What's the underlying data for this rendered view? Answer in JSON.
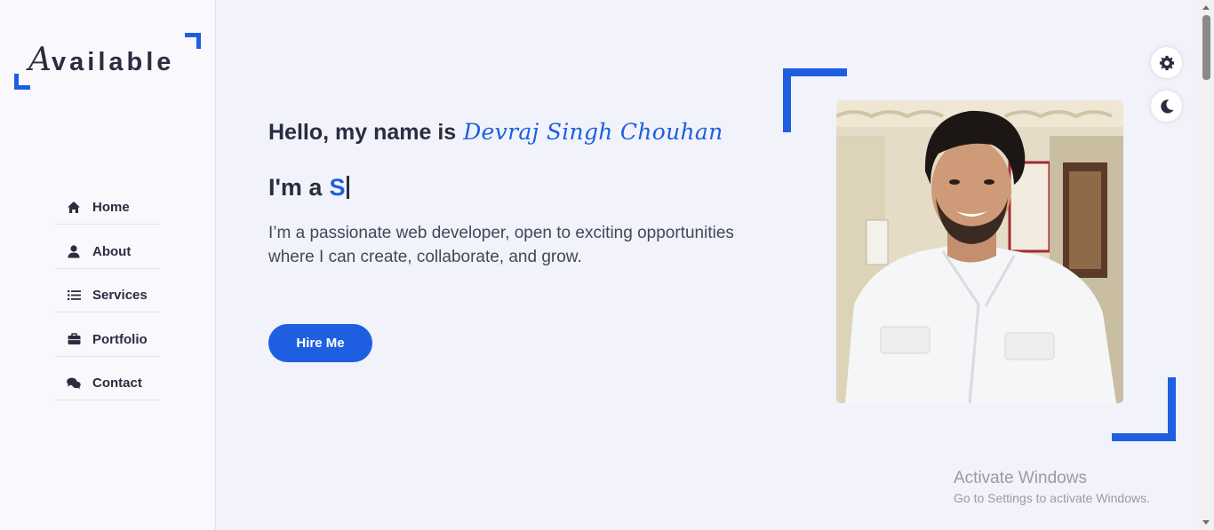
{
  "sidebar": {
    "logo": {
      "first_letter": "A",
      "rest": "vailable"
    },
    "nav": [
      {
        "label": "Home",
        "icon": "home-icon"
      },
      {
        "label": "About",
        "icon": "user-icon"
      },
      {
        "label": "Services",
        "icon": "list-icon"
      },
      {
        "label": "Portfolio",
        "icon": "briefcase-icon"
      },
      {
        "label": "Contact",
        "icon": "comments-icon"
      }
    ]
  },
  "hero": {
    "greeting": "Hello, my name is",
    "name": "Devraj Singh Chouhan",
    "role_prefix": "I'm a",
    "role_typed": "S",
    "description": "I’m a passionate web developer, open to exciting opportunities where I can create, collaborate, and grow.",
    "hire_button": "Hire Me",
    "photo": "profile-photo"
  },
  "switcher": {
    "settings_icon": "gear-icon",
    "theme_icon": "moon-icon"
  },
  "watermark": {
    "title": "Activate Windows",
    "subtitle": "Go to Settings to activate Windows."
  },
  "colors": {
    "accent": "#1d5fe0",
    "text": "#2b2c3f",
    "background": "#f2f2fb",
    "sidebar_bg": "#fbf8fd"
  }
}
